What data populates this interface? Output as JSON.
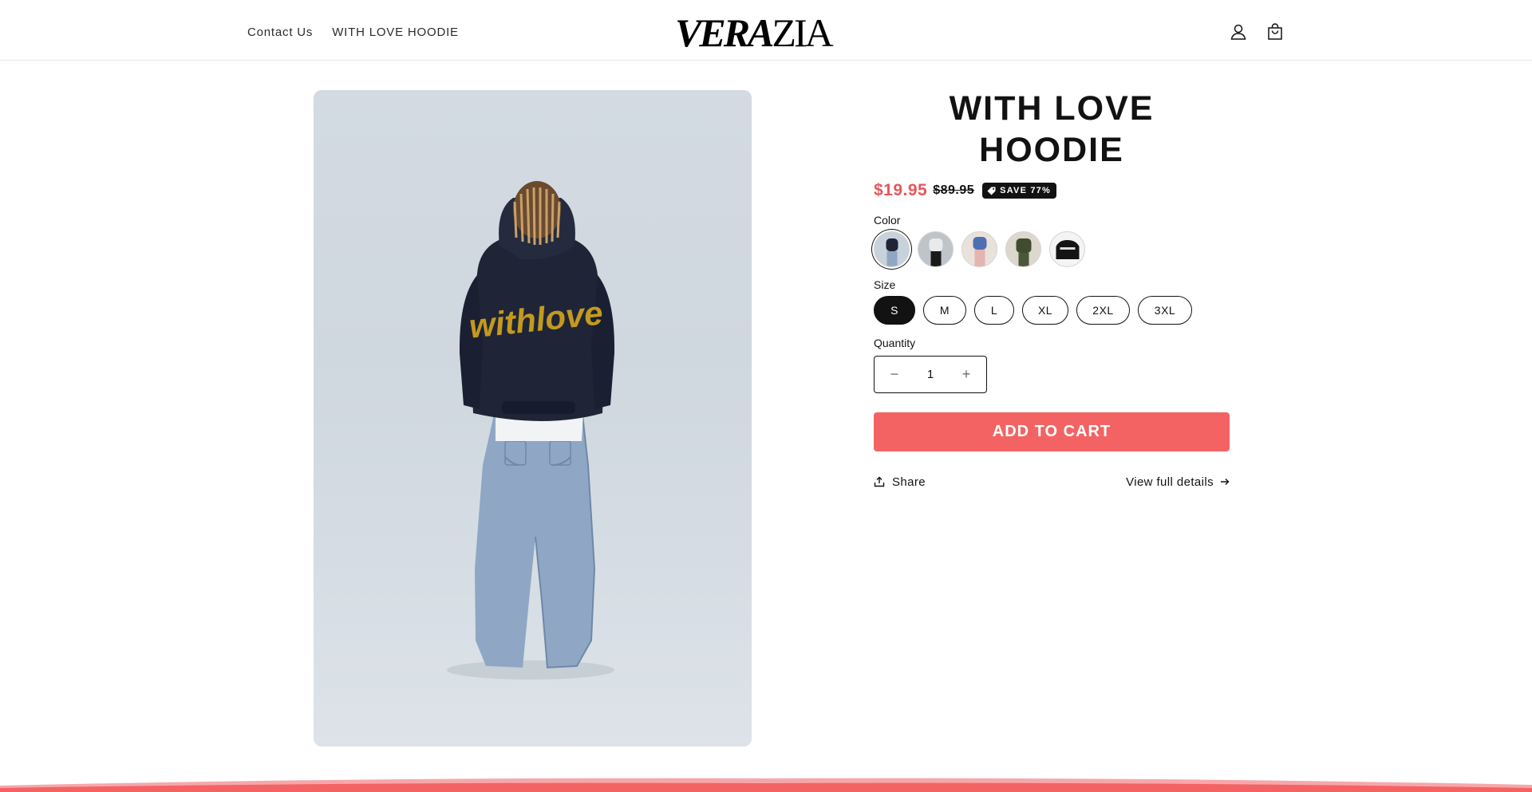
{
  "header": {
    "nav": [
      {
        "label": "Contact Us"
      },
      {
        "label": "WITH LOVE HOODIE"
      }
    ],
    "logo": {
      "bold": "VERA",
      "light": "ZIA"
    },
    "icons": [
      "account-icon",
      "cart-icon"
    ]
  },
  "product": {
    "title": "WITH LOVE HOODIE",
    "price_sale": "$19.95",
    "price_regular": "$89.95",
    "badge": "SAVE 77%",
    "color_label": "Color",
    "colors": [
      "navy-denim",
      "grey-black",
      "blue-pink",
      "olive",
      "black"
    ],
    "size_label": "Size",
    "sizes": [
      "S",
      "M",
      "L",
      "XL",
      "2XL",
      "3XL"
    ],
    "selected_size": "S",
    "quantity_label": "Quantity",
    "quantity": "1",
    "add_to_cart": "ADD TO CART",
    "share": "Share",
    "view_details": "View full details"
  },
  "colors": {
    "sale": "#e5575b",
    "button": "#f46363",
    "text": "#121212"
  }
}
